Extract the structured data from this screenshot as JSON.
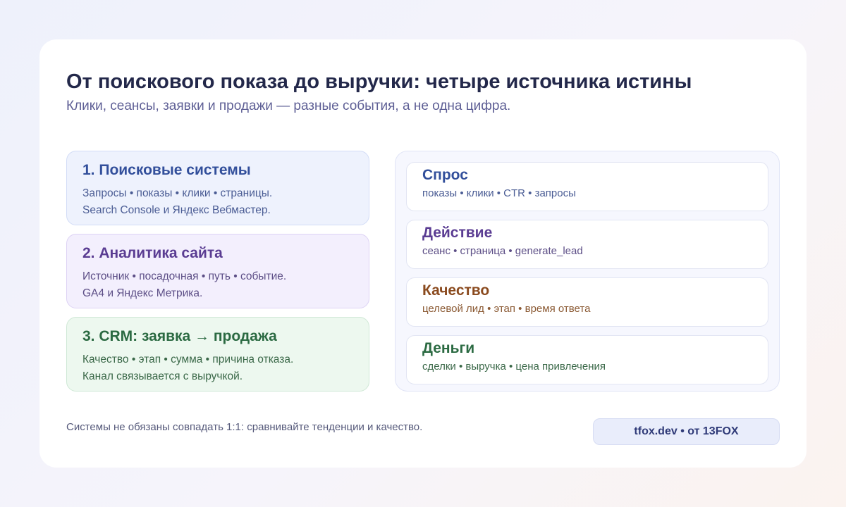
{
  "header": {
    "title": "От поискового показа до выручки: четыре источника истины",
    "subtitle": "Клики, сеансы, заявки и продажи — разные события, а не одна цифра."
  },
  "sources": [
    {
      "title": "1. Поисковые системы",
      "line1": "Запросы • показы • клики • страницы.",
      "line2": "Search Console и Яндекс Вебмастер."
    },
    {
      "title": "2. Аналитика сайта",
      "line1": "Источник • посадочная • путь • событие.",
      "line2": "GA4 и Яндекс Метрика."
    },
    {
      "title": "3. CRM: заявка → продажа",
      "line1": "Качество • этап • сумма • причина отказа.",
      "line2": "Канал связывается с выручкой."
    }
  ],
  "metrics": [
    {
      "title": "Спрос",
      "subtitle": "показы • клики • CTR • запросы"
    },
    {
      "title": "Действие",
      "subtitle": "сеанс • страница • generate_lead"
    },
    {
      "title": "Качество",
      "subtitle": "целевой лид • этап • время ответа"
    },
    {
      "title": "Деньги",
      "subtitle": "сделки • выручка • цена привлечения"
    }
  ],
  "footer": {
    "note": "Системы не обязаны совпадать 1:1: сравнивайте тенденции и качество.",
    "badge": "tfox.dev • от 13FOX"
  },
  "colors": {
    "search": "#324f9b",
    "analytics": "#5a3c92",
    "quality": "#8a4a1e",
    "crm": "#2b6a42"
  }
}
